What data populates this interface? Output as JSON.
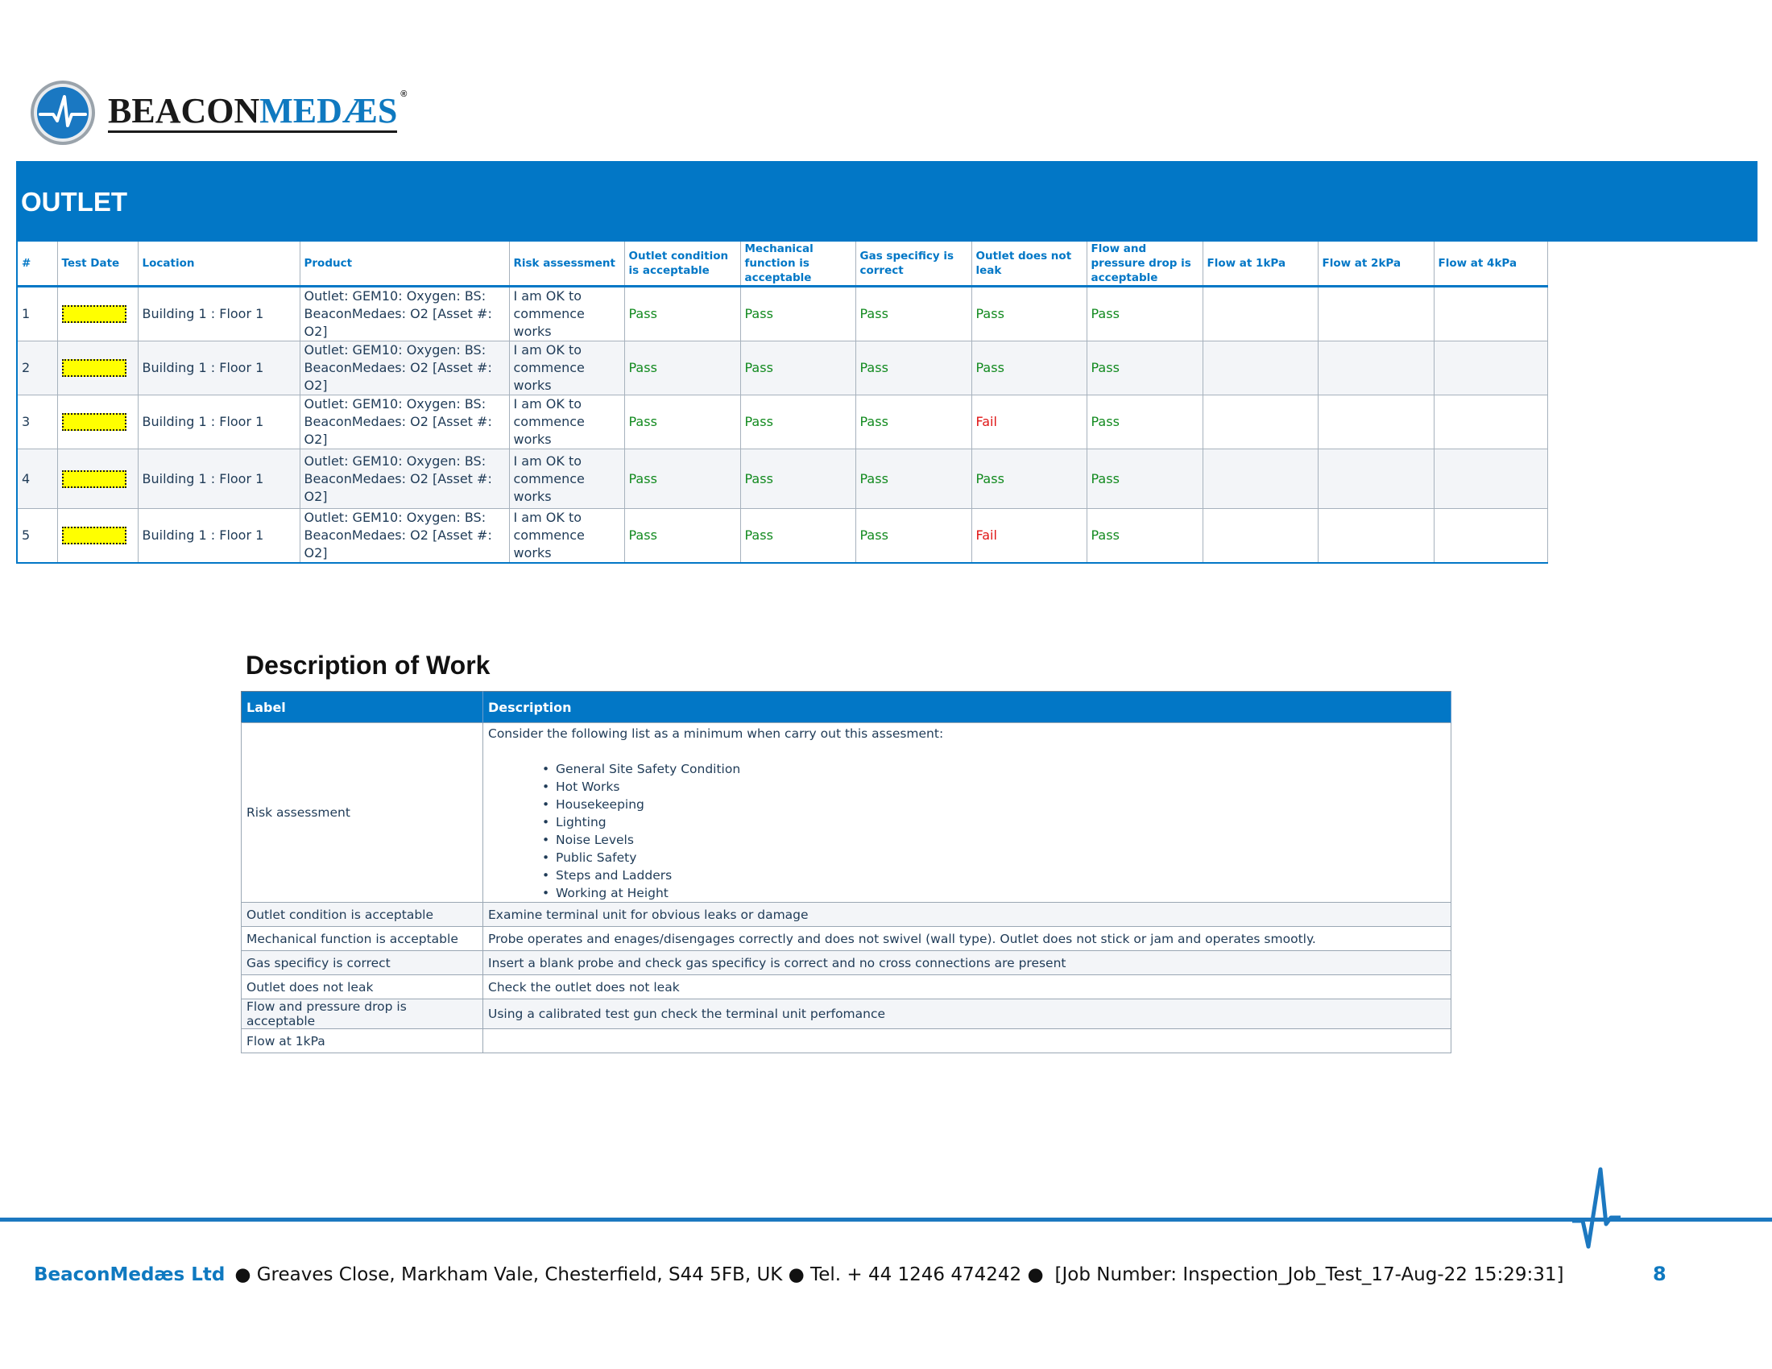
{
  "brand": {
    "logo_text_a": "BEACON",
    "logo_text_b": "MEDÆS",
    "logo_mark": "®",
    "accent": "#0277c6",
    "icon": "pulse-logo-icon"
  },
  "banner": {
    "title": "OUTLET"
  },
  "outlet_table": {
    "headers": [
      "#",
      "Test Date",
      "Location",
      "Product",
      "Risk assessment",
      "Outlet condition is acceptable",
      "Mechanical function is acceptable",
      "Gas specificy is correct",
      "Outlet does not leak",
      "Flow and pressure drop is acceptable",
      "Flow at 1kPa",
      "Flow at 2kPa",
      "Flow at 4kPa"
    ],
    "rows": [
      {
        "num": "1",
        "location": "Building 1 : Floor 1",
        "product_l1": "Outlet: GEM10: Oxygen: BS:",
        "product_l2": "BeaconMedaes: O2 [Asset #: O2]",
        "risk_l1": "I am OK to",
        "risk_l2": "commence works",
        "condition": "Pass",
        "mechanical": "Pass",
        "gas": "Pass",
        "leak": "Pass",
        "flow_drop": "Pass",
        "flow1": "",
        "flow2": "",
        "flow4": ""
      },
      {
        "num": "2",
        "location": "Building 1 : Floor 1",
        "product_l1": "Outlet: GEM10: Oxygen: BS:",
        "product_l2": "BeaconMedaes: O2 [Asset #: O2]",
        "risk_l1": "I am OK to",
        "risk_l2": "commence works",
        "condition": "Pass",
        "mechanical": "Pass",
        "gas": "Pass",
        "leak": "Pass",
        "flow_drop": "Pass",
        "flow1": "",
        "flow2": "",
        "flow4": ""
      },
      {
        "num": "3",
        "location": "Building 1 : Floor 1",
        "product_l1": "Outlet: GEM10: Oxygen: BS:",
        "product_l2": "BeaconMedaes: O2 [Asset #: O2]",
        "risk_l1": "I am OK to",
        "risk_l2": "commence works",
        "condition": "Pass",
        "mechanical": "Pass",
        "gas": "Pass",
        "leak": "Fail",
        "flow_drop": "Pass",
        "flow1": "",
        "flow2": "",
        "flow4": ""
      },
      {
        "num": "4",
        "location": "Building 1 : Floor 1",
        "product_l1": "Outlet: GEM10: Oxygen: BS:",
        "product_l2": "BeaconMedaes: O2 [Asset #: O2]",
        "risk_l1": "I am OK to",
        "risk_l2": "commence works",
        "condition": "Pass",
        "mechanical": "Pass",
        "gas": "Pass",
        "leak": "Pass",
        "flow_drop": "Pass",
        "flow1": "",
        "flow2": "",
        "flow4": ""
      },
      {
        "num": "5",
        "location": "Building 1 : Floor 1",
        "product_l1": "Outlet: GEM10: Oxygen: BS:",
        "product_l2": "BeaconMedaes: O2 [Asset #: O2]",
        "risk_l1": "I am OK to",
        "risk_l2": "commence works",
        "condition": "Pass",
        "mechanical": "Pass",
        "gas": "Pass",
        "leak": "Fail",
        "flow_drop": "Pass",
        "flow1": "",
        "flow2": "",
        "flow4": ""
      }
    ],
    "status_colors": {
      "pass": "#128a1f",
      "fail": "#e01616",
      "redaction": "#ffff00"
    }
  },
  "description": {
    "title": "Description of Work",
    "headers": [
      "Label",
      "Description"
    ],
    "risk_label": "Risk assessment",
    "risk_intro": "Consider the following list as a minimum when carry out this assesment:",
    "risk_items": [
      "General Site Safety Condition",
      "Hot Works",
      "Housekeeping",
      "Lighting",
      "Noise Levels",
      "Public Safety",
      "Steps and Ladders",
      "Working at Height"
    ],
    "rows": [
      {
        "label": "Outlet condition is acceptable",
        "desc": "Examine terminal unit for obvious leaks or damage"
      },
      {
        "label": "Mechanical function is acceptable",
        "desc": "Probe operates and enages/disengages correctly and does not swivel (wall type). Outlet does not stick or jam and operates smootly."
      },
      {
        "label": "Gas specificy is correct",
        "desc": "Insert a blank probe and check gas specificy is correct and no cross connections are present"
      },
      {
        "label": "Outlet does not leak",
        "desc": "Check the outlet does not leak"
      },
      {
        "label": "Flow and pressure drop is acceptable",
        "desc": "Using a calibrated test gun check the terminal unit perfomance"
      },
      {
        "label": "Flow at 1kPa",
        "desc": ""
      }
    ]
  },
  "footer": {
    "company": "BeaconMedæs Ltd",
    "address": "● Greaves Close, Markham Vale, Chesterfield, S44 5FB, UK ● Tel. + 44 1246 474242 ●",
    "job": "[Job Number: Inspection_Job_Test_17-Aug-22 15:29:31]",
    "page_number": "8"
  }
}
